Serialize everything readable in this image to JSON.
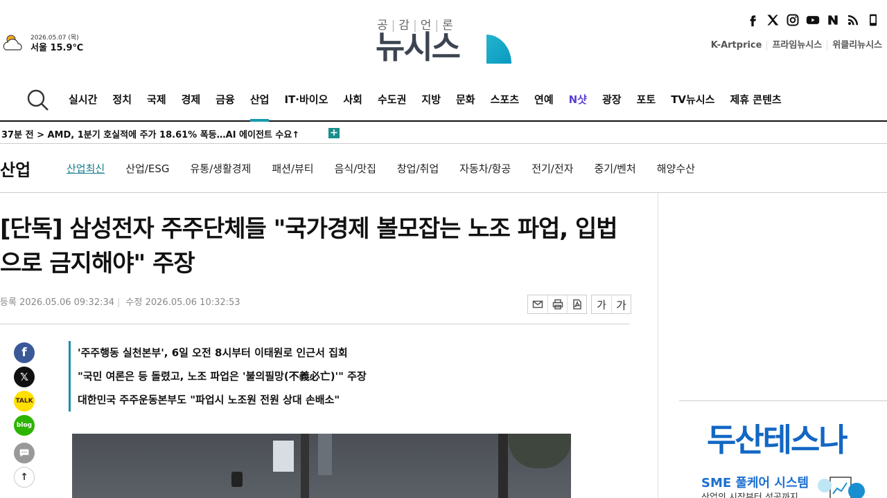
{
  "weather": {
    "date": "2026.05.07 (목)",
    "temperature": "서울 15.9℃",
    "icon": "partly-cloudy-icon"
  },
  "logo": {
    "tagline": [
      "공",
      "감",
      "언",
      "론"
    ],
    "name": "뉴시스"
  },
  "social": [
    "facebook-icon",
    "x-icon",
    "instagram-icon",
    "youtube-icon",
    "naver-icon",
    "rss-icon",
    "mobile-icon"
  ],
  "top_links": [
    "K-Artprice",
    "프라임뉴시스",
    "위클리뉴시스"
  ],
  "main_nav": {
    "items": [
      "실시간",
      "정치",
      "국제",
      "경제",
      "금융",
      "산업",
      "IT·바이오",
      "사회",
      "수도권",
      "지방",
      "문화",
      "스포츠",
      "연예",
      "N샷",
      "광장",
      "포토",
      "TV뉴시스",
      "제휴 콘텐츠"
    ],
    "active": "산업"
  },
  "breaking": {
    "text": "37분 전 > AMD, 1분기 호실적에 주가 18.61% 폭등…AI 에이전트 수요↑",
    "more": "+"
  },
  "section": {
    "title": "산업",
    "items": [
      "산업최신",
      "산업/ESG",
      "유통/생활경제",
      "패션/뷰티",
      "음식/맛집",
      "창업/취업",
      "자동차/항공",
      "전기/전자",
      "중기/벤처",
      "해양수산"
    ],
    "active": "산업최신"
  },
  "article": {
    "headline": "[단독] 삼성전자 주주단체들 \"국가경제 볼모잡는 노조 파업, 입법으로 금지해야\" 주장",
    "registered_label": "등록",
    "registered": "2026.05.06 09:32:34",
    "modified_label": "수정",
    "modified": "2026.05.06 10:32:53",
    "font_small": "가",
    "font_large": "가",
    "summary": [
      "'주주행동 실천본부', 6일 오전 8시부터 이태원로 인근서 집회",
      "\"국민 여론은 등 돌렸고, 노조 파업은 '불의필망(不義必亡)'\" 주장",
      "대한민국 주주운동본부도 \"파업시 노조원 전원 상대 손배소\""
    ]
  },
  "share": {
    "talk": "TALK",
    "blog": "blog"
  },
  "ad": {
    "brand": "두산테스나",
    "headline": "SME 풀케어 시스템",
    "sub": "산업의 시작부터 성공까지"
  }
}
